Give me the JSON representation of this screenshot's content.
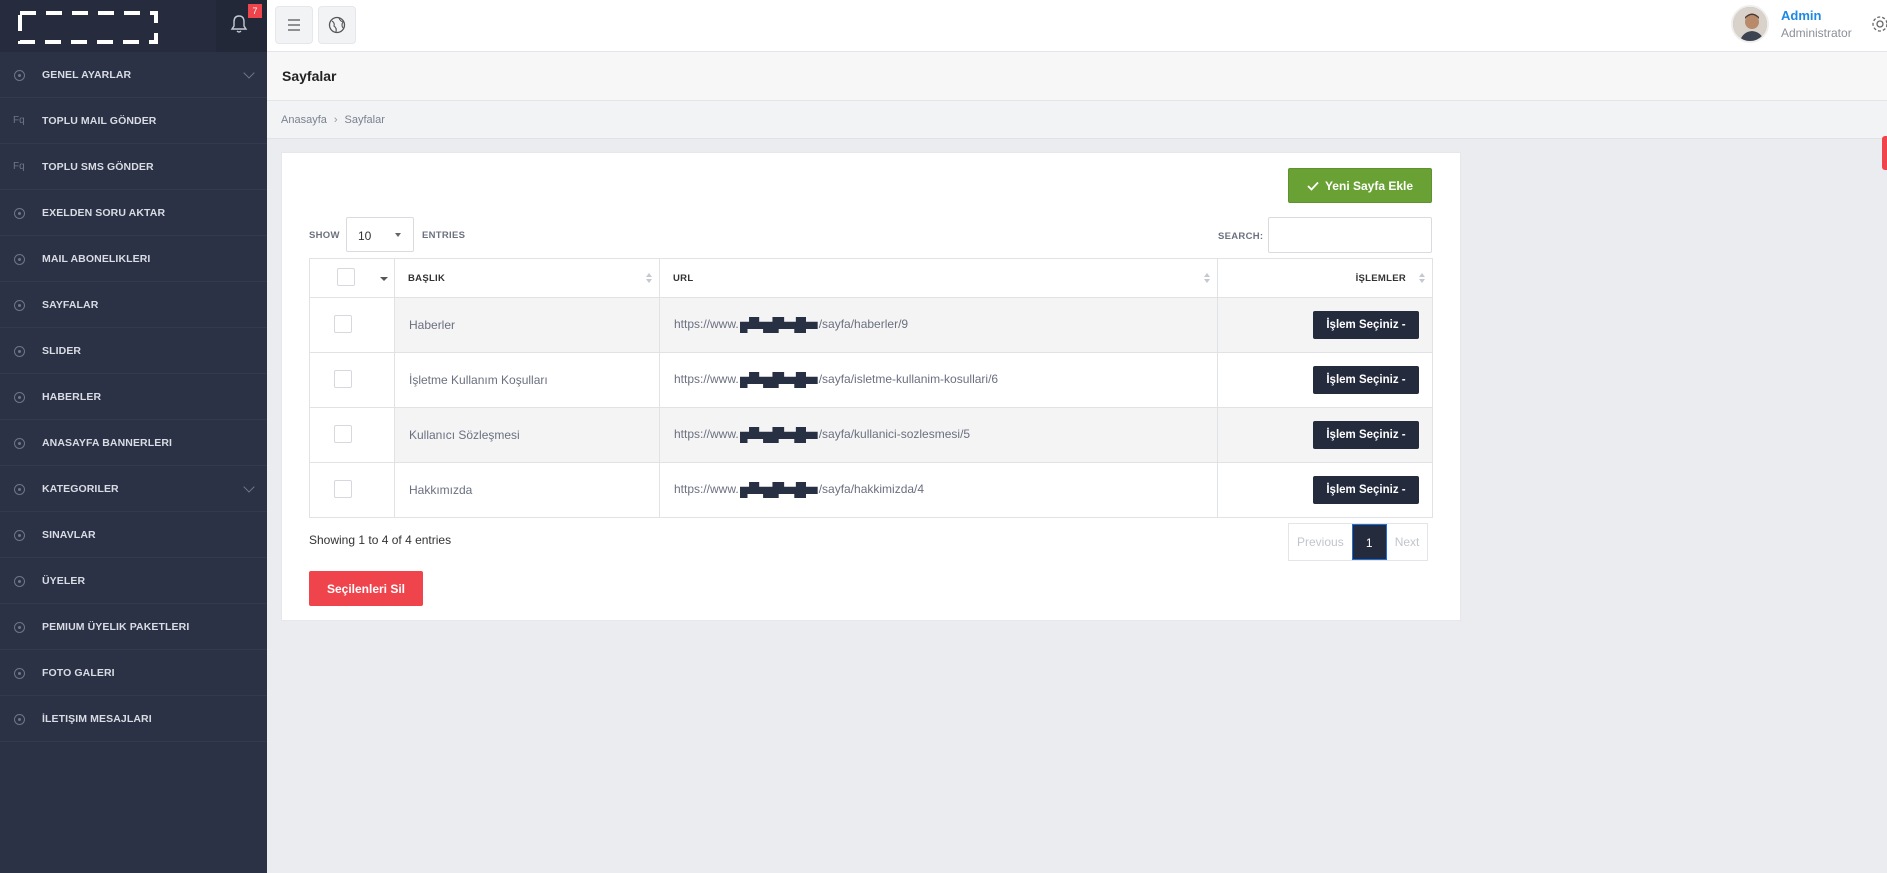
{
  "notifications": {
    "count": "7"
  },
  "sidebar": {
    "items": [
      {
        "label": "GENEL AYARLAR",
        "icon": "circle-icon",
        "submenu": true
      },
      {
        "label": "TOPLU MAIL GÖNDER",
        "icon": "fq-icon",
        "icon_text": "Fq"
      },
      {
        "label": "TOPLU SMS GÖNDER",
        "icon": "fq-icon",
        "icon_text": "Fq"
      },
      {
        "label": "EXELDEN SORU AKTAR",
        "icon": "circle-icon"
      },
      {
        "label": "MAIL ABONELIKLERI",
        "icon": "circle-icon"
      },
      {
        "label": "SAYFALAR",
        "icon": "circle-icon"
      },
      {
        "label": "SLIDER",
        "icon": "circle-icon"
      },
      {
        "label": "HABERLER",
        "icon": "circle-icon"
      },
      {
        "label": "ANASAYFA BANNERLERI",
        "icon": "circle-icon"
      },
      {
        "label": "KATEGORILER",
        "icon": "circle-icon",
        "submenu": true
      },
      {
        "label": "SINAVLAR",
        "icon": "circle-icon"
      },
      {
        "label": "ÜYELER",
        "icon": "circle-icon"
      },
      {
        "label": "PEMIUM ÜYELIK PAKETLERI",
        "icon": "circle-icon"
      },
      {
        "label": "FOTO GALERI",
        "icon": "circle-icon"
      },
      {
        "label": "İLETIŞIM MESAJLARI",
        "icon": "circle-icon"
      }
    ]
  },
  "user": {
    "name": "Admin",
    "role": "Administrator"
  },
  "page": {
    "title": "Sayfalar"
  },
  "breadcrumb": {
    "home": "Anasayfa",
    "current": "Sayfalar"
  },
  "toolbar": {
    "new_page_label": "Yeni Sayfa Ekle"
  },
  "table_controls": {
    "show_label": "SHOW",
    "page_length": "10",
    "entries_label": "ENTRIES",
    "search_label": "SEARCH:",
    "search_value": ""
  },
  "table": {
    "columns": [
      "BAŞLIK",
      "URL",
      "İŞLEMLER"
    ],
    "rows": [
      {
        "title": "Haberler",
        "url_prefix": "https://www.",
        "url_suffix": "/sayfa/haberler/9",
        "action": "İşlem Seçiniz"
      },
      {
        "title": "İşletme Kullanım Koşulları",
        "url_prefix": "https://www.",
        "url_suffix": "/sayfa/isletme-kullanim-kosullari/6",
        "action": "İşlem Seçiniz"
      },
      {
        "title": "Kullanıcı Sözleşmesi",
        "url_prefix": "https://www.",
        "url_suffix": "/sayfa/kullanici-sozlesmesi/5",
        "action": "İşlem Seçiniz"
      },
      {
        "title": "Hakkımızda",
        "url_prefix": "https://www.",
        "url_suffix": "/sayfa/hakkimizda/4",
        "action": "İşlem Seçiniz"
      }
    ]
  },
  "footer": {
    "showing": "Showing 1 to 4 of 4 entries",
    "prev": "Previous",
    "page": "1",
    "next": "Next",
    "delete_selected": "Seçilenleri Sil"
  },
  "colors": {
    "sidebar": "#2b3245",
    "accent_green": "#6aa135",
    "danger": "#f0444d",
    "dark_button": "#242b3d",
    "link_blue": "#1e88e5"
  }
}
